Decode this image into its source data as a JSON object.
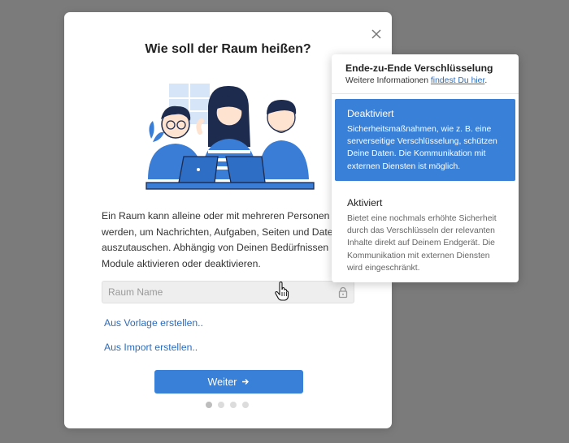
{
  "dialog": {
    "title": "Wie soll der Raum heißen?",
    "description": "Ein Raum kann alleine oder mit mehreren Personen genutzt\nwerden, um Nachrichten, Aufgaben, Seiten und Dateien\nauszutauschen. Abhängig von Deinen Bedürfnissen kannst\nModule aktivieren oder deaktivieren.",
    "name_placeholder": "Raum Name",
    "name_value": "",
    "link_template": "Aus Vorlage erstellen..",
    "link_import": "Aus Import erstellen..",
    "next_label": "Weiter",
    "next_icon": "arrow-right-icon",
    "close_icon": "close-icon",
    "lock_icon": "lock-icon",
    "steps_total": 4,
    "step_current": 1
  },
  "encryption_popover": {
    "title": "Ende-zu-Ende Verschlüsselung",
    "subtitle_prefix": "Weitere Informationen ",
    "subtitle_link": "findest Du hier",
    "subtitle_suffix": ".",
    "options": [
      {
        "title": "Deaktiviert",
        "description": "Sicherheitsmaßnahmen, wie z. B. eine\nserverseitige Verschlüsselung, schützen\nDeine Daten. Die Kommunikation mit\nexternen Diensten ist möglich.",
        "selected": true
      },
      {
        "title": "Aktiviert",
        "description": "Bietet eine nochmals erhöhte Sicherheit\ndurch das Verschlüsseln der relevanten\nInhalte direkt auf Deinem Endgerät. Die\nKommunikation mit externen Diensten\nwird eingeschränkt.",
        "selected": false
      }
    ]
  },
  "colors": {
    "overlay": "#7b7b7b",
    "accent": "#3880d8",
    "link": "#2d6cbb"
  }
}
